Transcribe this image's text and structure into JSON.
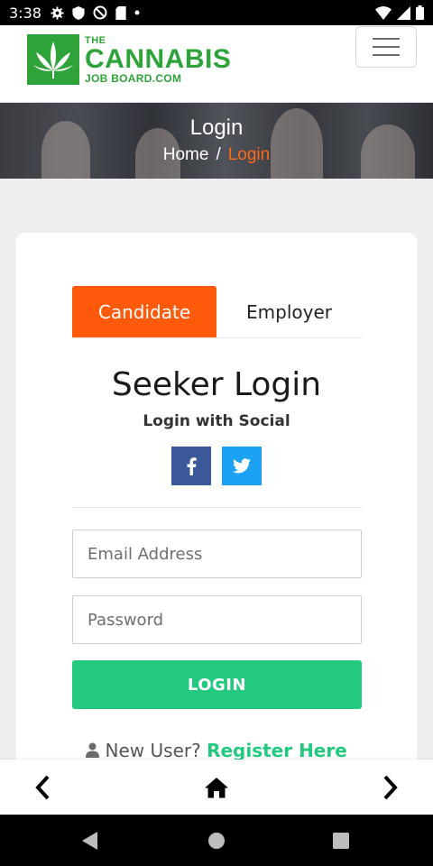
{
  "status_bar": {
    "time": "3:38"
  },
  "header": {
    "logo": {
      "line1": "THE",
      "line2": "CANNABIS",
      "line3": "JOB BOARD.COM"
    }
  },
  "banner": {
    "title": "Login",
    "breadcrumb": {
      "home": "Home",
      "separator": "/",
      "current": "Login"
    }
  },
  "login_card": {
    "tabs": [
      {
        "label": "Candidate",
        "active": true
      },
      {
        "label": "Employer",
        "active": false
      }
    ],
    "title": "Seeker Login",
    "social_title": "Login with Social",
    "email": {
      "placeholder": "Email Address",
      "value": ""
    },
    "password": {
      "placeholder": "Password",
      "value": ""
    },
    "login_button": "LOGIN",
    "new_user_text": "New User?",
    "register_link": "Register Here"
  },
  "icons": {
    "menu": "hamburger-icon",
    "facebook": "facebook-icon",
    "twitter": "twitter-icon",
    "user": "user-icon",
    "back": "chevron-left-icon",
    "home": "home-icon",
    "forward": "chevron-right-icon"
  },
  "colors": {
    "accent_orange": "#ff5a0a",
    "accent_green": "#22c97e",
    "brand_green": "#2ea33a",
    "facebook_blue": "#3b5998",
    "twitter_blue": "#1da1f2"
  }
}
